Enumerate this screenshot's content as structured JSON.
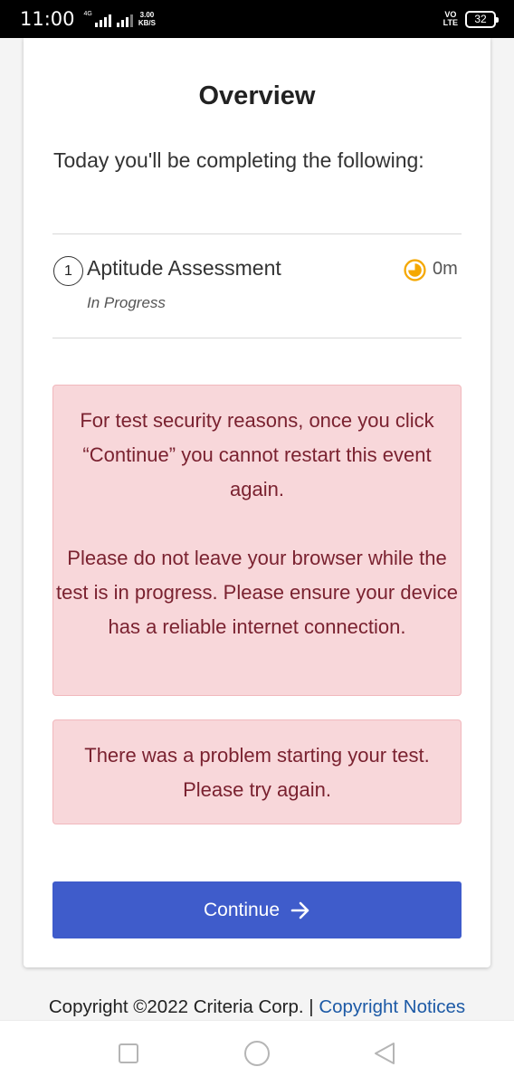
{
  "status_bar": {
    "time": "11:00",
    "network": "4G",
    "speed_value": "3.00",
    "speed_unit": "KB/S",
    "volte_top": "VO",
    "volte_bottom": "LTE",
    "battery": "32"
  },
  "overview": {
    "title": "Overview",
    "intro": "Today you'll be completing the following:",
    "step": {
      "number": "1",
      "name": "Aptitude Assessment",
      "status": "In Progress",
      "duration": "0m",
      "icon": "clock-icon",
      "icon_color": "#f5a800"
    },
    "security_notice": {
      "paragraph_1": "For test security reasons, once you click “Continue” you cannot restart this event again.",
      "paragraph_2": "Please do not leave your browser while the test is in progress. Please ensure your device has a reliable internet connection."
    },
    "error_message": "There was a problem starting your test. Please try again.",
    "continue_label": "Continue",
    "colors": {
      "primary": "#3f5ccb",
      "alert_bg": "#f8d7da",
      "alert_text": "#7a2230"
    }
  },
  "footer": {
    "copyright": "Copyright ©2022 Criteria Corp. |",
    "notices_link": "Copyright Notices"
  }
}
